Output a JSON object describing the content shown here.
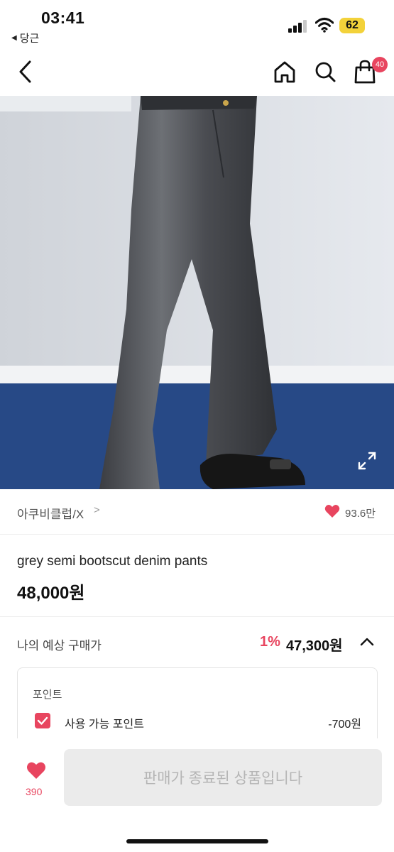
{
  "status": {
    "time": "03:41",
    "back_app": "당근",
    "battery": "62"
  },
  "nav": {
    "cart_count": "40"
  },
  "brand": {
    "name": "아쿠비클럽/X",
    "chevron": ">",
    "likes": "93.6만"
  },
  "product": {
    "title": "grey semi bootscut denim pants",
    "price": "48,000원"
  },
  "estimate": {
    "label": "나의 예상 구매가",
    "discount": "1%",
    "price": "47,300원"
  },
  "points": {
    "title": "포인트",
    "label": "사용 가능 포인트",
    "value": "-700원",
    "checked": true
  },
  "bottom": {
    "like_count": "390",
    "button_label": "판매가 종료된 상품입니다"
  },
  "colors": {
    "accent": "#e8455f",
    "battery": "#f3d23a"
  }
}
